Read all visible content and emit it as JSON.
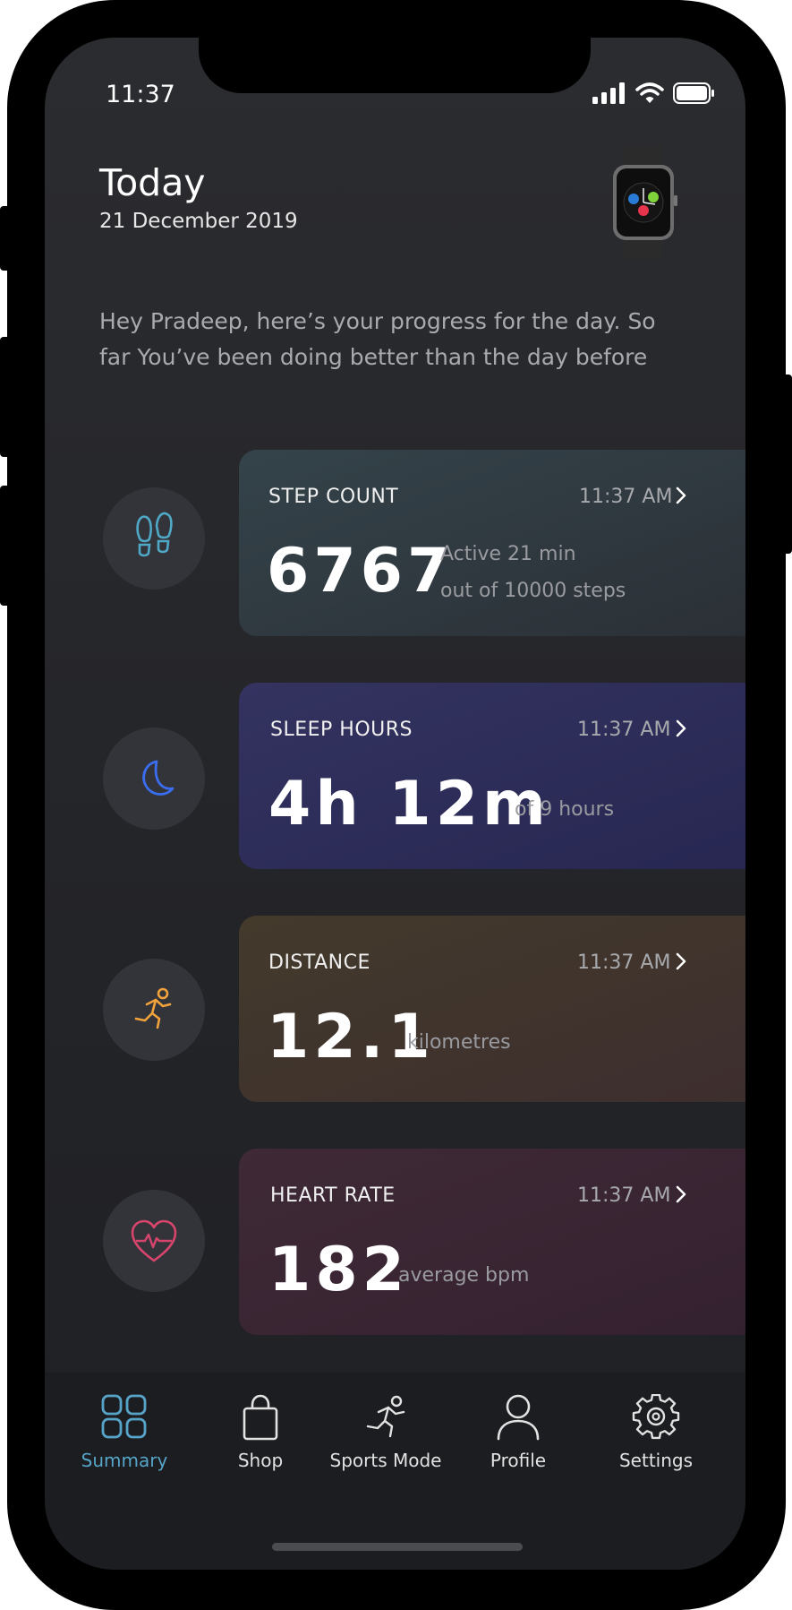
{
  "status": {
    "time": "11:37"
  },
  "header": {
    "title": "Today",
    "date": "21 December 2019"
  },
  "greeting": "Hey Pradeep, here’s your progress for the day. So far You’ve been doing better than the day before",
  "metrics": [
    {
      "label": "STEP COUNT",
      "time": "11:37 AM",
      "value": "6767",
      "sub1": "Active 21 min",
      "sub2": "out of 10000 steps",
      "icon": "footsteps-icon",
      "color": "#4fa9c6"
    },
    {
      "label": "SLEEP HOURS",
      "time": "11:37 AM",
      "value": "4h 12m",
      "sub1": "of 9 hours",
      "icon": "moon-icon",
      "color": "#3a6df0"
    },
    {
      "label": "DISTANCE",
      "time": "11:37 AM",
      "value": "12.1",
      "sub1": "kilometres",
      "icon": "runner-icon",
      "color": "#f2a23a"
    },
    {
      "label": "HEART RATE",
      "time": "11:37 AM",
      "value": "182",
      "sub1": "average bpm",
      "icon": "heart-pulse-icon",
      "color": "#d8456c"
    }
  ],
  "tabs": [
    {
      "label": "Summary",
      "icon": "grid-icon",
      "active": true
    },
    {
      "label": "Shop",
      "icon": "shopping-bag-icon"
    },
    {
      "label": "Sports Mode",
      "icon": "runner-icon"
    },
    {
      "label": "Profile",
      "icon": "person-icon"
    },
    {
      "label": "Settings",
      "icon": "gear-icon"
    }
  ],
  "colors": {
    "accent": "#56a5c8",
    "background": "#27282c"
  }
}
